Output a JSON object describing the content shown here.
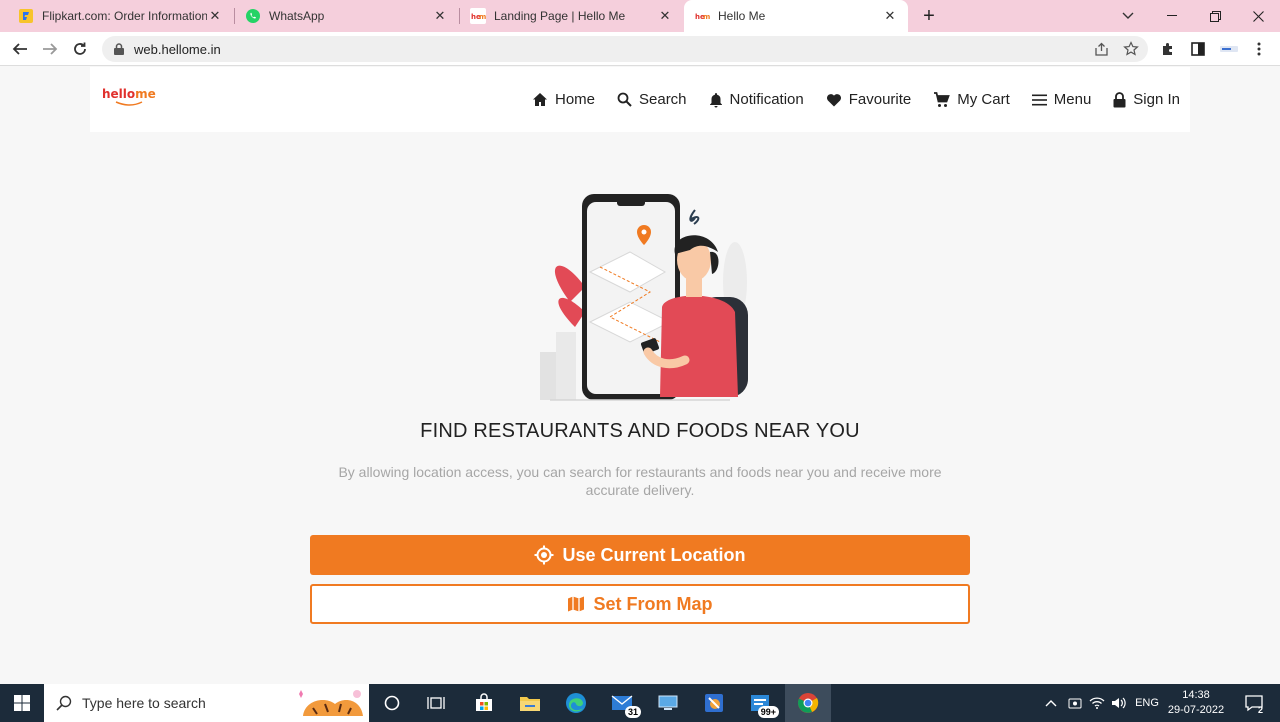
{
  "browser": {
    "tabs": [
      {
        "title": "Flipkart.com: Order Information"
      },
      {
        "title": "WhatsApp"
      },
      {
        "title": "Landing Page | Hello Me"
      },
      {
        "title": "Hello Me"
      }
    ],
    "close_glyph": "✕",
    "new_tab_glyph": "+",
    "url": "web.hellome.in"
  },
  "site": {
    "logo": {
      "part1": "hello",
      "part2": "me"
    },
    "nav": [
      {
        "label": "Home",
        "icon": "home-icon"
      },
      {
        "label": "Search",
        "icon": "search-icon"
      },
      {
        "label": "Notification",
        "icon": "bell-icon"
      },
      {
        "label": "Favourite",
        "icon": "heart-icon"
      },
      {
        "label": "My Cart",
        "icon": "cart-icon"
      },
      {
        "label": "Menu",
        "icon": "menu-icon"
      },
      {
        "label": "Sign In",
        "icon": "lock-icon"
      }
    ],
    "heading": "FIND RESTAURANTS AND FOODS NEAR YOU",
    "subtext": "By allowing location access, you can search for restaurants and foods near you and receive more accurate delivery.",
    "primary_button": "Use Current Location",
    "secondary_button": "Set From Map"
  },
  "colors": {
    "accent": "#f07a21",
    "logo_red": "#e0312d",
    "tabstrip": "#f5cfdc",
    "taskbar": "#1c2b3a"
  },
  "taskbar": {
    "search_placeholder": "Type here to search",
    "mail_badge": "31",
    "app_badge": "99+",
    "language": "ENG",
    "time": "14:38",
    "date": "29-07-2022",
    "notification_count": "2"
  }
}
